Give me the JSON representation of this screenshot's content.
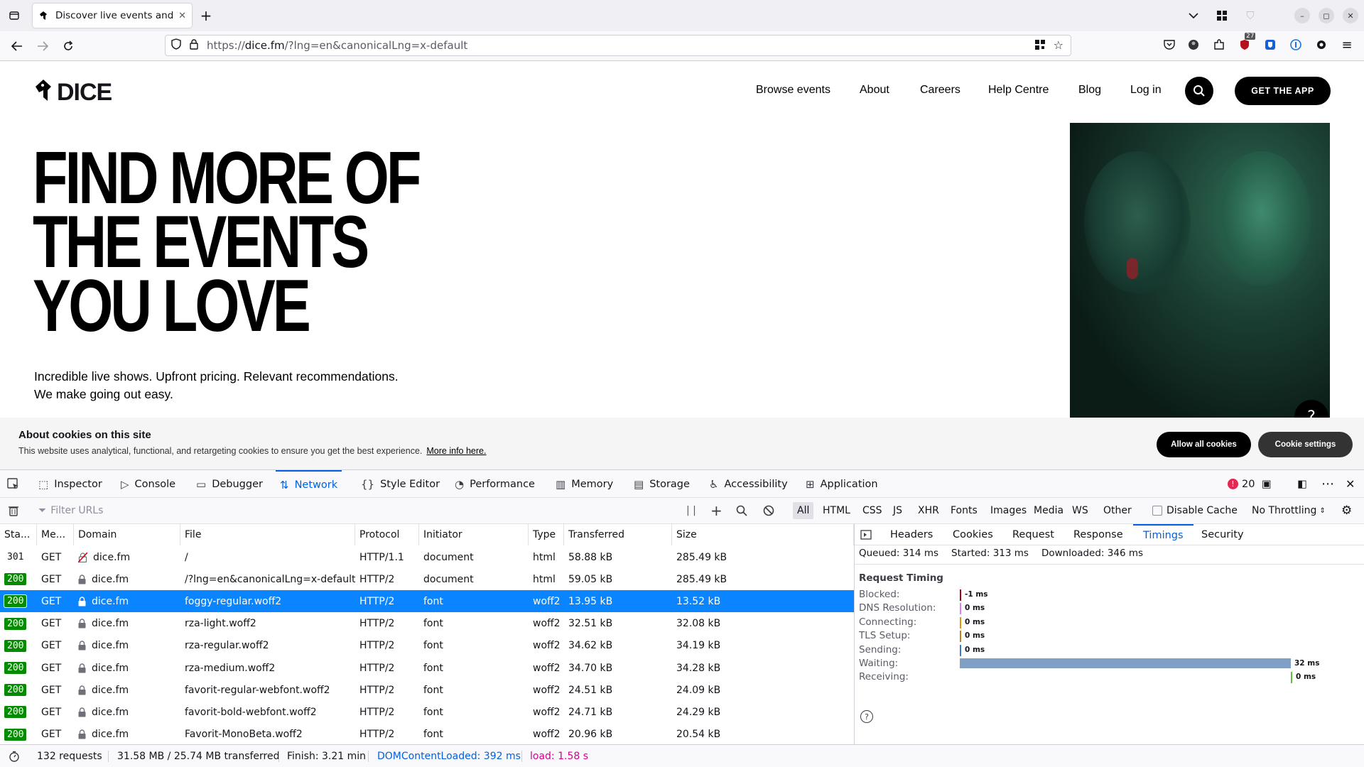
{
  "browser": {
    "tab_title": "Discover live events and",
    "url_prefix": "https://",
    "url_domain": "dice.fm",
    "url_path": "/?lng=en&canonicalLng=x-default",
    "extension_badge": "27"
  },
  "site": {
    "logo_text": "DICE",
    "nav": [
      "Browse events",
      "About",
      "Careers",
      "Help Centre",
      "Blog",
      "Log in"
    ],
    "get_app": "GET THE APP",
    "hero_lines": [
      "FIND MORE OF",
      "THE EVENTS",
      "YOU LOVE"
    ],
    "sub_lines": [
      "Incredible live shows. Upfront pricing. Relevant recommendations.",
      "We make going out easy."
    ]
  },
  "cookie": {
    "title": "About cookies on this site",
    "desc": "This website uses analytical, functional, and retargeting cookies to ensure you get the best experience.",
    "link": "More info here.",
    "allow": "Allow all cookies",
    "settings": "Cookie settings"
  },
  "devtools": {
    "tabs": [
      "Inspector",
      "Console",
      "Debugger",
      "Network",
      "Style Editor",
      "Performance",
      "Memory",
      "Storage",
      "Accessibility",
      "Application"
    ],
    "active_tab": "Network",
    "error_count": "20",
    "filter_placeholder": "Filter URLs",
    "type_filters": [
      "All",
      "HTML",
      "CSS",
      "JS",
      "XHR",
      "Fonts",
      "Images",
      "Media",
      "WS",
      "Other"
    ],
    "disable_cache": "Disable Cache",
    "throttling": "No Throttling",
    "columns": [
      "Sta...",
      "Me...",
      "Domain",
      "File",
      "Protocol",
      "Initiator",
      "Type",
      "Transferred",
      "Size"
    ],
    "requests": [
      {
        "status": "301",
        "method": "GET",
        "domain": "dice.fm",
        "file": "/",
        "protocol": "HTTP/1.1",
        "initiator": "document",
        "type": "html",
        "transferred": "58.88 kB",
        "size": "285.49 kB",
        "secure": false,
        "selected": false
      },
      {
        "status": "200",
        "method": "GET",
        "domain": "dice.fm",
        "file": "/?lng=en&canonicalLng=x-default",
        "protocol": "HTTP/2",
        "initiator": "document",
        "type": "html",
        "transferred": "59.05 kB",
        "size": "285.49 kB",
        "secure": true,
        "selected": false
      },
      {
        "status": "200",
        "method": "GET",
        "domain": "dice.fm",
        "file": "foggy-regular.woff2",
        "protocol": "HTTP/2",
        "initiator": "font",
        "type": "woff2",
        "transferred": "13.95 kB",
        "size": "13.52 kB",
        "secure": true,
        "selected": true
      },
      {
        "status": "200",
        "method": "GET",
        "domain": "dice.fm",
        "file": "rza-light.woff2",
        "protocol": "HTTP/2",
        "initiator": "font",
        "type": "woff2",
        "transferred": "32.51 kB",
        "size": "32.08 kB",
        "secure": true,
        "selected": false
      },
      {
        "status": "200",
        "method": "GET",
        "domain": "dice.fm",
        "file": "rza-regular.woff2",
        "protocol": "HTTP/2",
        "initiator": "font",
        "type": "woff2",
        "transferred": "34.62 kB",
        "size": "34.19 kB",
        "secure": true,
        "selected": false
      },
      {
        "status": "200",
        "method": "GET",
        "domain": "dice.fm",
        "file": "rza-medium.woff2",
        "protocol": "HTTP/2",
        "initiator": "font",
        "type": "woff2",
        "transferred": "34.70 kB",
        "size": "34.28 kB",
        "secure": true,
        "selected": false
      },
      {
        "status": "200",
        "method": "GET",
        "domain": "dice.fm",
        "file": "favorit-regular-webfont.woff2",
        "protocol": "HTTP/2",
        "initiator": "font",
        "type": "woff2",
        "transferred": "24.51 kB",
        "size": "24.09 kB",
        "secure": true,
        "selected": false
      },
      {
        "status": "200",
        "method": "GET",
        "domain": "dice.fm",
        "file": "favorit-bold-webfont.woff2",
        "protocol": "HTTP/2",
        "initiator": "font",
        "type": "woff2",
        "transferred": "24.71 kB",
        "size": "24.29 kB",
        "secure": true,
        "selected": false
      },
      {
        "status": "200",
        "method": "GET",
        "domain": "dice.fm",
        "file": "Favorit-MonoBeta.woff2",
        "protocol": "HTTP/2",
        "initiator": "font",
        "type": "woff2",
        "transferred": "20.96 kB",
        "size": "20.54 kB",
        "secure": true,
        "selected": false
      }
    ],
    "status_bar": {
      "requests": "132 requests",
      "transferred": "31.58 MB / 25.74 MB transferred",
      "finish": "Finish: 3.21 min",
      "dcl": "DOMContentLoaded: 392 ms",
      "load": "load: 1.58 s"
    },
    "side_tabs": [
      "Headers",
      "Cookies",
      "Request",
      "Response",
      "Timings",
      "Security"
    ],
    "side_active": "Timings",
    "timing_summary": {
      "queued": "Queued: 314 ms",
      "started": "Started: 313 ms",
      "downloaded": "Downloaded: 346 ms"
    },
    "request_timing_title": "Request Timing",
    "timings": [
      {
        "label": "Blocked:",
        "value": "-1 ms",
        "ms": -1,
        "color": "#a4000f"
      },
      {
        "label": "DNS Resolution:",
        "value": "0 ms",
        "ms": 0,
        "color": "#e07ef0"
      },
      {
        "label": "Connecting:",
        "value": "0 ms",
        "ms": 0,
        "color": "#e8900c"
      },
      {
        "label": "TLS Setup:",
        "value": "0 ms",
        "ms": 0,
        "color": "#c08020"
      },
      {
        "label": "Sending:",
        "value": "0 ms",
        "ms": 0,
        "color": "#3b7dc2"
      },
      {
        "label": "Waiting:",
        "value": "32 ms",
        "ms": 32,
        "color": "#7f9fc4"
      },
      {
        "label": "Receiving:",
        "value": "0 ms",
        "ms": 0,
        "color": "#5fbf3a"
      }
    ]
  }
}
